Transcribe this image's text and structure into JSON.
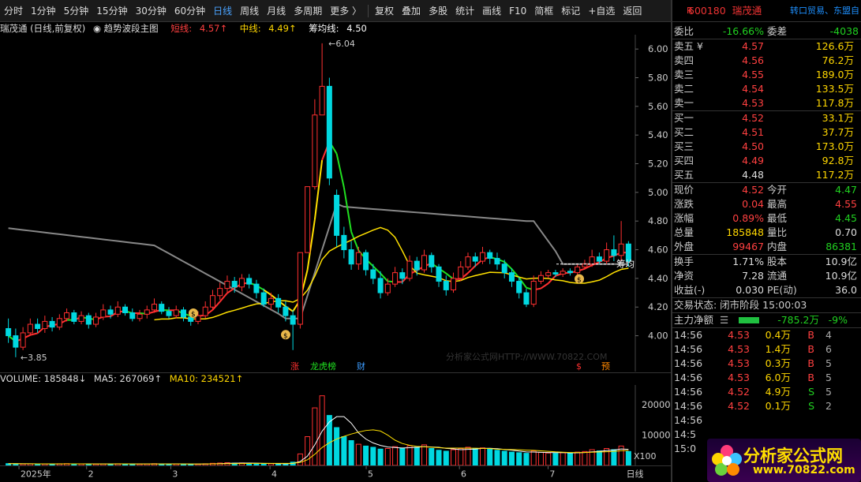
{
  "toolbar": {
    "items": [
      "分时",
      "1分钟",
      "5分钟",
      "15分钟",
      "30分钟",
      "60分钟",
      "日线",
      "周线",
      "月线",
      "多周期",
      "更多 〉"
    ],
    "right_items": [
      "复权",
      "叠加",
      "多股",
      "统计",
      "画线",
      "F10",
      "简框",
      "标记",
      "+自选",
      "返回"
    ],
    "active": "日线"
  },
  "chart_header": {
    "title": "瑞茂通 (日线,前复权)",
    "indicator": "趋势波段主图",
    "short_label": "短线:",
    "short_value": "4.57↑",
    "mid_label": "中线:",
    "mid_value": "4.49↑",
    "chip_label": "筹均线:",
    "chip_value": "4.50"
  },
  "vol_header": {
    "volume": "VOLUME: 185848↓",
    "ma5": "MA5: 267069↑",
    "ma10": "MA10: 234521↑"
  },
  "chart_data": {
    "type": "candlestick",
    "ylim": [
      3.75,
      6.1
    ],
    "y_ticks": [
      "6.00",
      "5.80",
      "5.60",
      "5.40",
      "5.20",
      "5.00",
      "4.80",
      "4.60",
      "4.40",
      "4.20",
      "4.00"
    ],
    "vol_ticks": [
      "20000",
      "10000"
    ],
    "vol_unit": "X100",
    "date_labels": [
      "2025年",
      "2",
      "3",
      "4",
      "5",
      "6",
      "7"
    ],
    "period_label": "日线",
    "high_mark": "6.04",
    "low_mark": "3.85",
    "chip_tag": "筹均",
    "candles": [
      [
        4.05,
        4.0,
        4.12,
        3.95
      ],
      [
        4.0,
        3.92,
        4.05,
        3.85
      ],
      [
        3.92,
        4.02,
        4.06,
        3.9
      ],
      [
        4.02,
        4.08,
        4.12,
        4.0
      ],
      [
        4.08,
        4.05,
        4.12,
        4.02
      ],
      [
        4.05,
        4.1,
        4.14,
        4.02
      ],
      [
        4.1,
        4.06,
        4.13,
        4.03
      ],
      [
        4.06,
        4.12,
        4.15,
        4.04
      ],
      [
        4.12,
        4.16,
        4.19,
        4.1
      ],
      [
        4.16,
        4.1,
        4.18,
        4.08
      ],
      [
        4.1,
        4.14,
        4.17,
        4.08
      ],
      [
        4.14,
        4.08,
        4.16,
        4.05
      ],
      [
        4.08,
        4.13,
        4.16,
        4.06
      ],
      [
        4.13,
        4.18,
        4.22,
        4.11
      ],
      [
        4.18,
        4.15,
        4.21,
        4.12
      ],
      [
        4.15,
        4.2,
        4.24,
        4.13
      ],
      [
        4.2,
        4.16,
        4.22,
        4.14
      ],
      [
        4.16,
        4.12,
        4.19,
        4.1
      ],
      [
        4.12,
        4.15,
        4.18,
        4.1
      ],
      [
        4.15,
        4.18,
        4.21,
        4.12
      ],
      [
        4.18,
        4.22,
        4.26,
        4.16
      ],
      [
        4.22,
        4.17,
        4.24,
        4.15
      ],
      [
        4.17,
        4.14,
        4.2,
        4.12
      ],
      [
        4.14,
        4.18,
        4.21,
        4.12
      ],
      [
        4.18,
        4.13,
        4.2,
        4.1
      ],
      [
        4.13,
        4.1,
        4.16,
        4.07
      ],
      [
        4.1,
        4.14,
        4.17,
        4.08
      ],
      [
        4.14,
        4.2,
        4.24,
        4.12
      ],
      [
        4.2,
        4.28,
        4.32,
        4.18
      ],
      [
        4.28,
        4.33,
        4.37,
        4.25
      ],
      [
        4.33,
        4.38,
        4.42,
        4.3
      ],
      [
        4.38,
        4.34,
        4.41,
        4.3
      ],
      [
        4.34,
        4.4,
        4.43,
        4.31
      ],
      [
        4.4,
        4.36,
        4.43,
        4.33
      ],
      [
        4.36,
        4.3,
        4.39,
        4.26
      ],
      [
        4.3,
        4.22,
        4.33,
        4.2
      ],
      [
        4.22,
        4.26,
        4.3,
        4.18
      ],
      [
        4.26,
        4.2,
        4.29,
        4.16
      ],
      [
        4.2,
        4.14,
        4.24,
        4.1
      ],
      [
        4.14,
        4.08,
        4.18,
        3.9
      ],
      [
        4.08,
        4.58,
        4.58,
        4.05
      ],
      [
        4.58,
        5.04,
        5.04,
        4.9
      ],
      [
        5.04,
        5.54,
        5.65,
        5.02
      ],
      [
        5.54,
        5.74,
        6.04,
        5.7
      ],
      [
        5.74,
        5.1,
        5.8,
        5.05
      ],
      [
        4.98,
        4.7,
        5.02,
        4.62
      ],
      [
        4.7,
        4.6,
        4.76,
        4.54
      ],
      [
        4.6,
        4.5,
        4.66,
        4.46
      ],
      [
        4.5,
        4.58,
        4.62,
        4.46
      ],
      [
        4.58,
        4.46,
        4.6,
        4.42
      ],
      [
        4.46,
        4.4,
        4.5,
        4.36
      ],
      [
        4.4,
        4.3,
        4.45,
        4.26
      ],
      [
        4.3,
        4.36,
        4.4,
        4.28
      ],
      [
        4.36,
        4.44,
        4.48,
        4.34
      ],
      [
        4.44,
        4.4,
        4.47,
        4.36
      ],
      [
        4.4,
        4.52,
        4.56,
        4.38
      ],
      [
        4.52,
        4.46,
        4.55,
        4.42
      ],
      [
        4.46,
        4.56,
        4.6,
        4.44
      ],
      [
        4.56,
        4.48,
        4.58,
        4.44
      ],
      [
        4.48,
        4.38,
        4.5,
        4.34
      ],
      [
        4.38,
        4.32,
        4.42,
        4.28
      ],
      [
        4.32,
        4.4,
        4.44,
        4.3
      ],
      [
        4.4,
        4.48,
        4.52,
        4.38
      ],
      [
        4.48,
        4.55,
        4.58,
        4.46
      ],
      [
        4.55,
        4.52,
        4.58,
        4.48
      ],
      [
        4.52,
        4.58,
        4.62,
        4.5
      ],
      [
        4.58,
        4.54,
        4.6,
        4.5
      ],
      [
        4.54,
        4.5,
        4.58,
        4.46
      ],
      [
        4.5,
        4.44,
        4.53,
        4.4
      ],
      [
        4.44,
        4.38,
        4.47,
        4.34
      ],
      [
        4.38,
        4.3,
        4.41,
        4.26
      ],
      [
        4.3,
        4.22,
        4.33,
        4.2
      ],
      [
        4.22,
        4.38,
        4.42,
        4.2
      ],
      [
        4.38,
        4.42,
        4.45,
        4.36
      ],
      [
        4.42,
        4.44,
        4.46,
        4.4
      ],
      [
        4.44,
        4.43,
        4.46,
        4.41
      ],
      [
        4.43,
        4.45,
        4.47,
        4.41
      ],
      [
        4.45,
        4.44,
        4.47,
        4.42
      ],
      [
        4.44,
        4.48,
        4.5,
        4.42
      ],
      [
        4.48,
        4.5,
        4.53,
        4.46
      ],
      [
        4.5,
        4.55,
        4.6,
        4.48
      ],
      [
        4.55,
        4.52,
        4.58,
        4.5
      ],
      [
        4.52,
        4.6,
        4.65,
        4.5
      ],
      [
        4.6,
        4.56,
        4.7,
        4.52
      ],
      [
        4.56,
        4.64,
        4.8,
        4.52
      ],
      [
        4.64,
        4.52,
        4.66,
        4.48
      ]
    ],
    "volumes": [
      60,
      55,
      48,
      52,
      45,
      50,
      46,
      55,
      60,
      50,
      48,
      44,
      46,
      52,
      50,
      55,
      48,
      42,
      46,
      50,
      58,
      52,
      45,
      48,
      44,
      40,
      46,
      55,
      70,
      80,
      90,
      75,
      82,
      70,
      60,
      55,
      58,
      50,
      55,
      110,
      380,
      950,
      1900,
      2300,
      1650,
      1250,
      950,
      820,
      700,
      640,
      600,
      540,
      560,
      620,
      560,
      650,
      600,
      680,
      560,
      500,
      470,
      520,
      560,
      600,
      550,
      580,
      540,
      500,
      470,
      440,
      420,
      400,
      480,
      430,
      410,
      400,
      420,
      410,
      440,
      460,
      520,
      480,
      560,
      520,
      640,
      460
    ]
  },
  "orderbook": {
    "weibi_label": "委比",
    "weibi": "-16.66%",
    "weicha_label": "委差",
    "weicha": "-4038",
    "asks": [
      {
        "label": "卖五 ¥",
        "price": "4.57",
        "vol": "126.6万"
      },
      {
        "label": "卖四",
        "price": "4.56",
        "vol": "76.2万"
      },
      {
        "label": "卖三",
        "price": "4.55",
        "vol": "189.0万"
      },
      {
        "label": "卖二",
        "price": "4.54",
        "vol": "133.5万"
      },
      {
        "label": "卖一",
        "price": "4.53",
        "vol": "117.8万"
      }
    ],
    "bids": [
      {
        "label": "买一",
        "price": "4.52",
        "vol": "33.1万"
      },
      {
        "label": "买二",
        "price": "4.51",
        "vol": "37.7万"
      },
      {
        "label": "买三",
        "price": "4.50",
        "vol": "173.0万"
      },
      {
        "label": "买四",
        "price": "4.49",
        "vol": "92.8万"
      },
      {
        "label": "买五",
        "price": "4.48",
        "vol": "117.2万"
      }
    ]
  },
  "quote": {
    "rows": [
      {
        "l1": "现价",
        "v1": "4.52",
        "l2": "今开",
        "v2": "4.47"
      },
      {
        "l1": "涨跌",
        "v1": "0.04",
        "l2": "最高",
        "v2": "4.55"
      },
      {
        "l1": "涨幅",
        "v1": "0.89%",
        "l2": "最低",
        "v2": "4.45"
      },
      {
        "l1": "总量",
        "v1": "185848",
        "l2": "量比",
        "v2": "0.70"
      },
      {
        "l1": "外盘",
        "v1": "99467",
        "l2": "内盘",
        "v2": "86381"
      }
    ],
    "rows2": [
      {
        "l1": "换手",
        "v1": "1.71%",
        "l2": "股本",
        "v2": "10.9亿"
      },
      {
        "l1": "净资",
        "v1": "7.28",
        "l2": "流通",
        "v2": "10.9亿"
      },
      {
        "l1": "收益(-)",
        "v1": "0.030",
        "l2": "PE(动)",
        "v2": "36.0"
      }
    ],
    "status": "交易状态: 闭市阶段 15:00:03",
    "main_flow_label": "主力净额",
    "main_flow_value": "-785.2万",
    "main_flow_pct": "-9%"
  },
  "stock": {
    "code": "600180",
    "name": "瑞茂通",
    "tag": "转口贸易、东盟自",
    "marker": "R"
  },
  "trades": [
    {
      "t": "14:56",
      "p": "4.53",
      "v": "0.4万",
      "bs": "B",
      "n": "4"
    },
    {
      "t": "14:56",
      "p": "4.53",
      "v": "1.4万",
      "bs": "B",
      "n": "6"
    },
    {
      "t": "14:56",
      "p": "4.53",
      "v": "0.3万",
      "bs": "B",
      "n": "5"
    },
    {
      "t": "14:56",
      "p": "4.53",
      "v": "6.0万",
      "bs": "B",
      "n": "5"
    },
    {
      "t": "14:56",
      "p": "4.52",
      "v": "4.9万",
      "bs": "S",
      "n": "5"
    },
    {
      "t": "14:56",
      "p": "4.52",
      "v": "0.1万",
      "bs": "S",
      "n": "2"
    },
    {
      "t": "14:56",
      "p": "",
      "v": "",
      "bs": "",
      "n": ""
    },
    {
      "t": "14:5",
      "p": "",
      "v": "",
      "bs": "",
      "n": ""
    },
    {
      "t": "15:0",
      "p": "",
      "v": "",
      "bs": "",
      "n": ""
    }
  ],
  "logo": {
    "text": "分析家公式网",
    "url": "www.70822.com"
  },
  "watermark": "分析家公式网HTTP://WWW.70822.COM",
  "event_tags": [
    "涨",
    "龙虎榜",
    "财",
    "$",
    "预"
  ]
}
